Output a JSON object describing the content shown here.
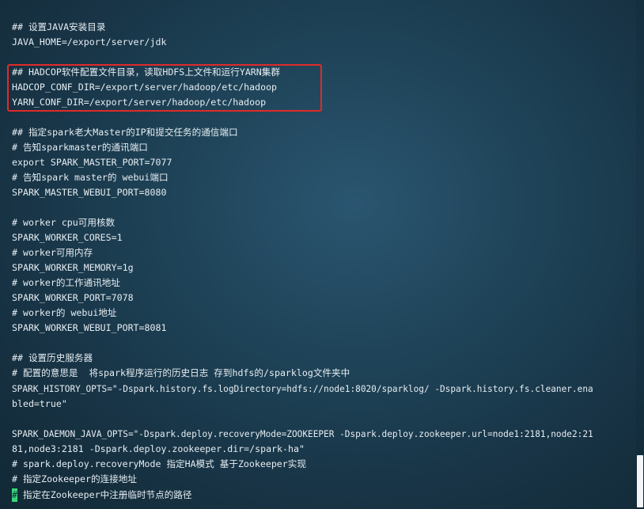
{
  "terminal": {
    "lines": [
      "## 设置JAVA安装目录",
      "JAVA_HOME=/export/server/jdk",
      "",
      "## HADCOP软件配置文件目录，读取HDFS上文件和运行YARN集群",
      "HADCOP_CONF_DIR=/export/server/hadoop/etc/hadoop",
      "YARN_CONF_DIR=/export/server/hadoop/etc/hadoop",
      "",
      "## 指定spark老大Master的IP和提交任务的通信端口",
      "# 告知sparkmaster的通讯端口",
      "export SPARK_MASTER_PORT=7077",
      "# 告知spark master的 webui端口",
      "SPARK_MASTER_WEBUI_PORT=8080",
      "",
      "# worker cpu可用核数",
      "SPARK_WORKER_CORES=1",
      "# worker可用内存",
      "SPARK_WORKER_MEMORY=1g",
      "# worker的工作通讯地址",
      "SPARK_WORKER_PORT=7078",
      "# worker的 webui地址",
      "SPARK_WORKER_WEBUI_PORT=8081",
      "",
      "## 设置历史服务器",
      "# 配置的意思是  将spark程序运行的历史日志 存到hdfs的/sparklog文件夹中",
      "SPARK_HISTORY_OPTS=\"-Dspark.history.fs.logDirectory=hdfs://node1:8020/sparklog/ -Dspark.history.fs.cleaner.ena",
      "bled=true\"",
      "",
      "SPARK_DAEMON_JAVA_OPTS=\"-Dspark.deploy.recoveryMode=ZOOKEEPER -Dspark.deploy.zookeeper.url=node1:2181,node2:21",
      "81,node3:2181 -Dspark.deploy.zookeeper.dir=/spark-ha\"",
      "# spark.deploy.recoveryMode 指定HA模式 基于Zookeeper实现",
      "# 指定Zookeeper的连接地址",
      "# 指定在Zookeeper中注册临时节点的路径"
    ],
    "cursor_char": "#",
    "cursor_rest": " 指定在Zookeeper中注册临时节点的路径",
    "colors": {
      "text": "#e6edf2",
      "highlight_border": "#e02a2a",
      "cursor": "#37d67a"
    }
  }
}
